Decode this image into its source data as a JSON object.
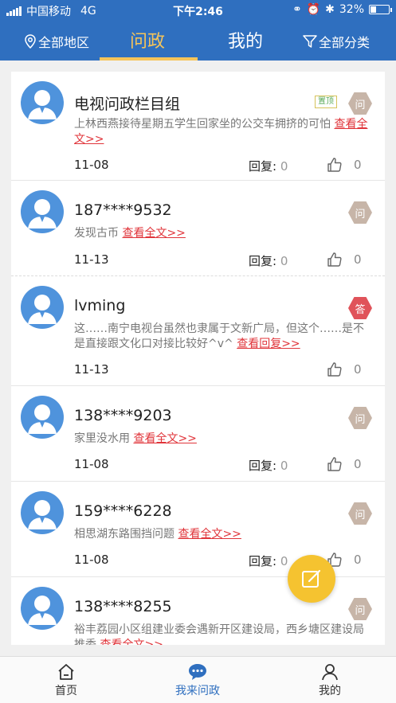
{
  "status": {
    "carrier": "中国移动",
    "network": "4G",
    "time": "下午2:46",
    "battery_text": "32%",
    "battery_level": 0.32
  },
  "nav": {
    "region": "全部地区",
    "tab_ask": "问政",
    "tab_mine": "我的",
    "category": "全部分类"
  },
  "posts": [
    {
      "name": "电视问政栏目组",
      "pinned_label": "置顶",
      "badge": "问",
      "badge_type": "q",
      "content": "上林西燕接待星期五学生回家坐的公交车拥挤的可怕",
      "more": "查看全文>>",
      "date": "11-08",
      "reply_label": "回复:",
      "reply_count": "0",
      "likes": "0"
    },
    {
      "name": "187****9532",
      "badge": "问",
      "badge_type": "q",
      "content": "发现古币",
      "more": "查看全文>>",
      "date": "11-13",
      "reply_label": "回复:",
      "reply_count": "0",
      "likes": "0"
    },
    {
      "name": "lvming",
      "badge": "答",
      "badge_type": "a",
      "content": "这……南宁电视台虽然也隶属于文新广局，但这个……是不是直接跟文化口对接比较好^v^",
      "more": "查看回复>>",
      "date": "11-13",
      "likes": "0"
    },
    {
      "name": "138****9203",
      "badge": "问",
      "badge_type": "q",
      "content": "家里没水用",
      "more": "查看全文>>",
      "date": "11-08",
      "reply_label": "回复:",
      "reply_count": "0",
      "likes": "0"
    },
    {
      "name": "159****6228",
      "badge": "问",
      "badge_type": "q",
      "content": "相思湖东路围挡问题",
      "more": "查看全文>>",
      "date": "11-08",
      "reply_label": "回复:",
      "reply_count": "0",
      "likes": "0"
    },
    {
      "name": "138****8255",
      "badge": "问",
      "badge_type": "q",
      "content": "裕丰荔园小区组建业委会遇新开区建设局，西乡塘区建设局推委",
      "more": "查看全文>>"
    }
  ],
  "tabbar": {
    "home": "首页",
    "ask": "我来问政",
    "mine": "我的"
  },
  "colors": {
    "primary": "#2f6fbf",
    "accent": "#f5c45a",
    "link": "#e0343a",
    "fab": "#f5c330"
  },
  "icons": {
    "region": "location-pin-icon",
    "category": "filter-icon",
    "like": "thumbs-up-icon",
    "fab": "compose-icon",
    "home": "home-icon",
    "ask": "chat-bubble-icon",
    "mine": "person-icon"
  }
}
